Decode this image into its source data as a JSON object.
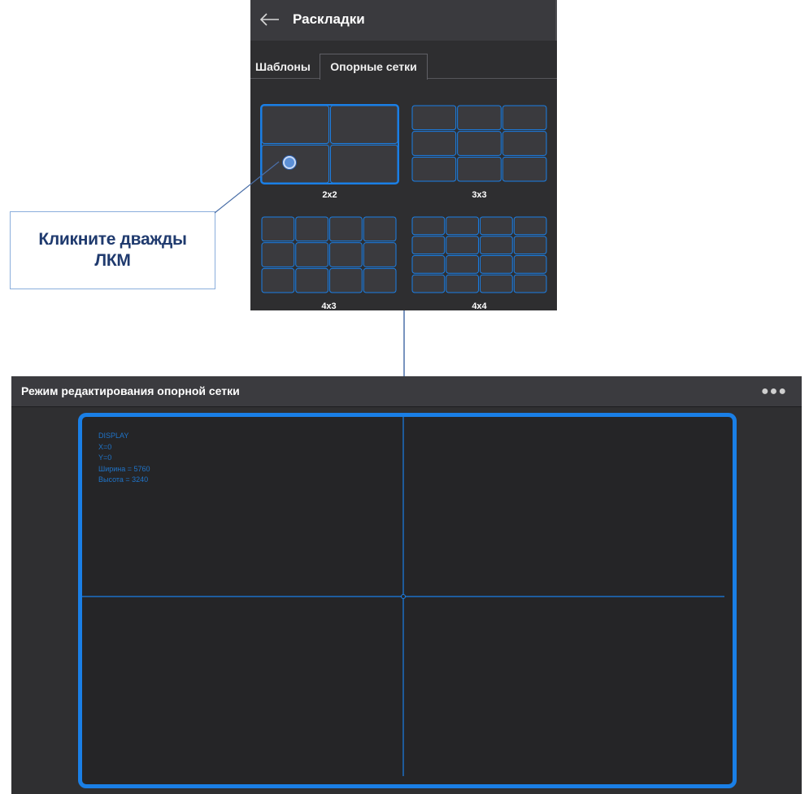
{
  "layouts_panel": {
    "title": "Раскладки",
    "back_icon": "arrow-left-icon",
    "tabs": [
      {
        "label": "Шаблоны",
        "active": false
      },
      {
        "label": "Опорные сетки",
        "active": true
      }
    ],
    "grids": [
      {
        "label": "2x2",
        "cols": 2,
        "rows": 2,
        "selected": true
      },
      {
        "label": "3x3",
        "cols": 3,
        "rows": 3,
        "selected": false
      },
      {
        "label": "4x3",
        "cols": 4,
        "rows": 3,
        "selected": false
      },
      {
        "label": "4x4",
        "cols": 4,
        "rows": 4,
        "selected": false
      }
    ]
  },
  "callout": {
    "line1": "Кликните дважды",
    "line2": "ЛКМ"
  },
  "editor": {
    "title": "Режим редактирования опорной сетки",
    "more_icon": "more-dots-icon",
    "grid": {
      "cols": 2,
      "rows": 2
    },
    "display_info": {
      "name": "DISPLAY",
      "x": "X=0",
      "y": "Y=0",
      "width": "Ширина = 5760",
      "height": "Высота = 3240"
    }
  },
  "colors": {
    "accent": "#1a7fe6",
    "panel_bg": "#2e2e30",
    "header_bg": "#3a3a3e",
    "callout_text": "#1f3a6e",
    "connector": "#4a6fa8"
  }
}
